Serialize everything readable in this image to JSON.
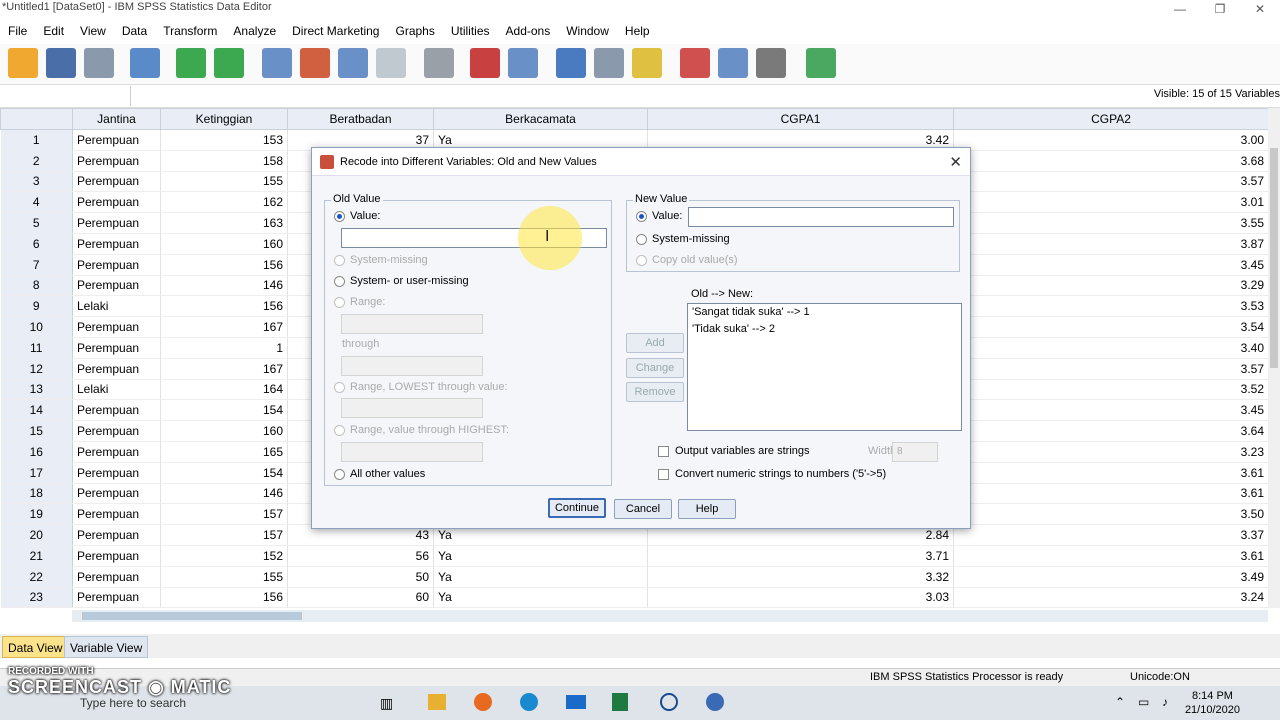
{
  "window": {
    "title": "*Untitled1 [DataSet0] - IBM SPSS Statistics Data Editor"
  },
  "menu": [
    "File",
    "Edit",
    "View",
    "Data",
    "Transform",
    "Analyze",
    "Direct Marketing",
    "Graphs",
    "Utilities",
    "Add-ons",
    "Window",
    "Help"
  ],
  "visible_vars": "Visible: 15 of 15 Variables",
  "columns": [
    "",
    "Jantina",
    "Ketinggian",
    "Beratbadan",
    "Berkacamata",
    "CGPA1",
    "CGPA2"
  ],
  "rows": [
    [
      "1",
      "Perempuan",
      "153",
      "37",
      "Ya",
      "3.42",
      "3.00"
    ],
    [
      "2",
      "Perempuan",
      "158",
      "",
      "",
      "",
      "3.68"
    ],
    [
      "3",
      "Perempuan",
      "155",
      "",
      "",
      "",
      "3.57"
    ],
    [
      "4",
      "Perempuan",
      "162",
      "",
      "",
      "",
      "3.01"
    ],
    [
      "5",
      "Perempuan",
      "163",
      "",
      "",
      "",
      "3.55"
    ],
    [
      "6",
      "Perempuan",
      "160",
      "",
      "",
      "",
      "3.87"
    ],
    [
      "7",
      "Perempuan",
      "156",
      "",
      "",
      "",
      "3.45"
    ],
    [
      "8",
      "Perempuan",
      "146",
      "",
      "",
      "",
      "3.29"
    ],
    [
      "9",
      "Lelaki",
      "156",
      "",
      "",
      "",
      "3.53"
    ],
    [
      "10",
      "Perempuan",
      "167",
      "",
      "",
      "",
      "3.54"
    ],
    [
      "11",
      "Perempuan",
      "1",
      "",
      "",
      "",
      "3.40"
    ],
    [
      "12",
      "Perempuan",
      "167",
      "",
      "",
      "",
      "3.57"
    ],
    [
      "13",
      "Lelaki",
      "164",
      "",
      "",
      "",
      "3.52"
    ],
    [
      "14",
      "Perempuan",
      "154",
      "",
      "",
      "",
      "3.45"
    ],
    [
      "15",
      "Perempuan",
      "160",
      "",
      "",
      "",
      "3.64"
    ],
    [
      "16",
      "Perempuan",
      "165",
      "",
      "",
      "",
      "3.23"
    ],
    [
      "17",
      "Perempuan",
      "154",
      "",
      "",
      "",
      "3.61"
    ],
    [
      "18",
      "Perempuan",
      "146",
      "",
      "",
      "",
      "3.61"
    ],
    [
      "19",
      "Perempuan",
      "157",
      "",
      "",
      "",
      "3.50"
    ],
    [
      "20",
      "Perempuan",
      "157",
      "43",
      "Ya",
      "2.84",
      "3.37"
    ],
    [
      "21",
      "Perempuan",
      "152",
      "56",
      "Ya",
      "3.71",
      "3.61"
    ],
    [
      "22",
      "Perempuan",
      "155",
      "50",
      "Ya",
      "3.32",
      "3.49"
    ],
    [
      "23",
      "Perempuan",
      "156",
      "60",
      "Ya",
      "3.03",
      "3.24"
    ]
  ],
  "tabs": {
    "data_view": "Data View",
    "variable_view": "Variable View"
  },
  "status": {
    "processor": "IBM SPSS Statistics Processor is ready",
    "unicode": "Unicode:ON"
  },
  "dialog": {
    "title": "Recode into Different Variables: Old and New Values",
    "old_value": {
      "legend": "Old Value",
      "value": "Value:",
      "system_missing": "System-missing",
      "sys_user_missing": "System- or user-missing",
      "range": "Range:",
      "through": "through",
      "range_lowest": "Range, LOWEST through value:",
      "range_highest": "Range, value through HIGHEST:",
      "all_other": "All other values"
    },
    "new_value": {
      "legend": "New Value",
      "value": "Value:",
      "system_missing": "System-missing",
      "copy_old": "Copy old value(s)"
    },
    "old_new_label": "Old --> New:",
    "mappings": [
      "'Sangat tidak suka' --> 1",
      "'Tidak suka' --> 2"
    ],
    "buttons": {
      "add": "Add",
      "change": "Change",
      "remove": "Remove",
      "continue": "Continue",
      "cancel": "Cancel",
      "help": "Help"
    },
    "output_strings": "Output variables are strings",
    "width_label": "Width:",
    "width_value": "8",
    "convert_numeric": "Convert numeric strings to numbers ('5'->5)"
  },
  "taskbar": {
    "search": "Type here to search",
    "time": "8:14 PM",
    "date": "21/10/2020"
  },
  "watermark": {
    "line1": "RECORDED WITH",
    "line2": "SCREENCAST",
    "line3": "MATIC"
  }
}
